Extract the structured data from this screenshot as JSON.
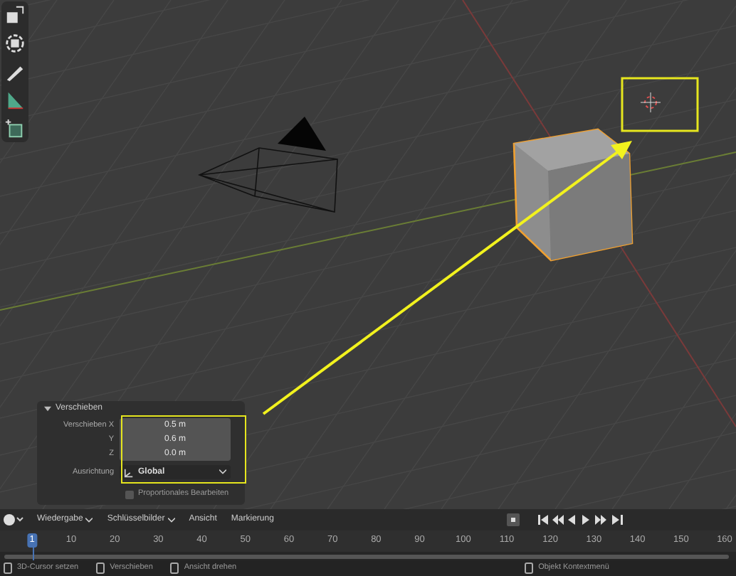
{
  "scene": {
    "cube": {
      "selected": true
    }
  },
  "operator_panel": {
    "title": "Verschieben",
    "expanded": true,
    "fields": [
      {
        "label": "Verschieben X",
        "value": "0.5 m"
      },
      {
        "label": "Y",
        "value": "0.6 m"
      },
      {
        "label": "Z",
        "value": "0.0 m"
      }
    ],
    "orientation": {
      "label": "Ausrichtung",
      "value": "Global"
    },
    "proportional_editing": {
      "label": "Proportionales Bearbeiten",
      "checked": false
    }
  },
  "timeline": {
    "menus": [
      {
        "label": "Wiedergabe",
        "dropdown": true
      },
      {
        "label": "Schlüsselbilder",
        "dropdown": true
      },
      {
        "label": "Ansicht",
        "dropdown": false
      },
      {
        "label": "Markierung",
        "dropdown": false
      }
    ],
    "frames": [
      {
        "label": "1",
        "selected": true
      },
      {
        "label": "10",
        "selected": false
      },
      {
        "label": "20",
        "selected": false
      },
      {
        "label": "30",
        "selected": false
      },
      {
        "label": "40",
        "selected": false
      },
      {
        "label": "50",
        "selected": false
      },
      {
        "label": "60",
        "selected": false
      },
      {
        "label": "70",
        "selected": false
      },
      {
        "label": "80",
        "selected": false
      },
      {
        "label": "90",
        "selected": false
      },
      {
        "label": "100",
        "selected": false
      },
      {
        "label": "110",
        "selected": false
      },
      {
        "label": "120",
        "selected": false
      },
      {
        "label": "130",
        "selected": false
      },
      {
        "label": "140",
        "selected": false
      },
      {
        "label": "150",
        "selected": false
      },
      {
        "label": "160",
        "selected": false
      }
    ]
  },
  "status_bar": [
    {
      "label": "3D-Cursor setzen"
    },
    {
      "label": "Verschieben"
    },
    {
      "label": "Ansicht drehen"
    },
    {
      "label": "Objekt Kontextmenü"
    }
  ]
}
